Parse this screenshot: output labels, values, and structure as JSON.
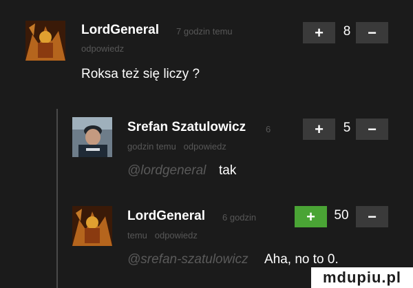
{
  "comments": [
    {
      "username": "LordGeneral",
      "meta_line1": "7 godzin temu",
      "meta_line2": "odpowiedz",
      "text": "Roksa też się liczy ?",
      "score": "8",
      "upvote_icon": "plus-icon",
      "downvote_icon": "minus-icon"
    },
    {
      "username": "Srefan Szatulowicz",
      "meta_line1": "6",
      "meta_line2": "godzin temu   odpowiedz",
      "mention": "@lordgeneral",
      "text": "tak",
      "score": "5",
      "upvote_icon": "plus-icon",
      "downvote_icon": "minus-icon"
    },
    {
      "username": "LordGeneral",
      "meta_line1": "6 godzin",
      "meta_line2": "temu   odpowiedz",
      "mention": "@srefan-szatulowicz",
      "text": "Aha, no to 0.",
      "score": "50",
      "upvote_icon": "plus-icon",
      "downvote_icon": "minus-icon",
      "upvote_active_color": "#4aa435"
    }
  ],
  "buttons": {
    "plus": "+",
    "minus": "−"
  },
  "watermark": "mdupiu.pl",
  "colors": {
    "background": "#1b1b1b",
    "button": "#3a3a3a",
    "meta": "#575757"
  }
}
